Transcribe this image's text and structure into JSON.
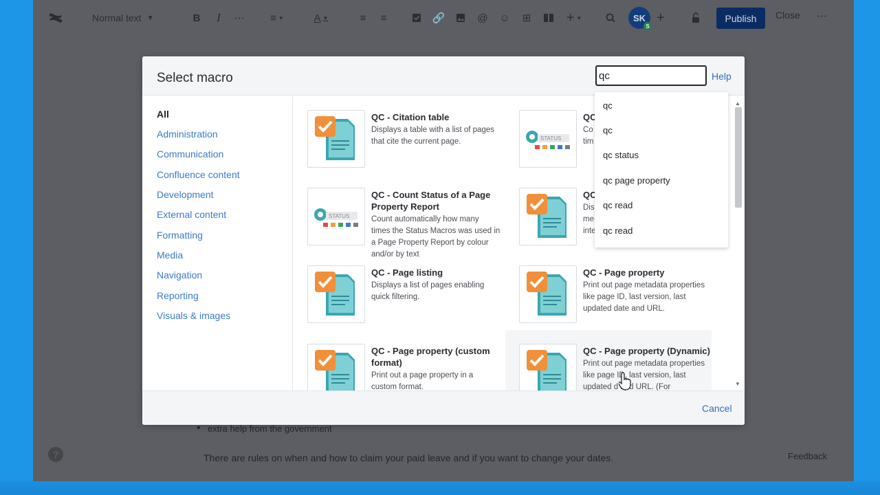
{
  "toolbar": {
    "text_style": "Normal text",
    "avatar_initials": "SK",
    "avatar_badge": "S",
    "publish_label": "Publish",
    "close_label": "Close"
  },
  "modal": {
    "title": "Select macro",
    "search_value": "qc",
    "help_label": "Help",
    "cancel_label": "Cancel",
    "categories": [
      {
        "label": "All"
      },
      {
        "label": "Administration"
      },
      {
        "label": "Communication"
      },
      {
        "label": "Confluence content"
      },
      {
        "label": "Development"
      },
      {
        "label": "External content"
      },
      {
        "label": "Formatting"
      },
      {
        "label": "Media"
      },
      {
        "label": "Navigation"
      },
      {
        "label": "Reporting"
      },
      {
        "label": "Visuals & images"
      }
    ],
    "macros": [
      {
        "title": "QC - Citation table",
        "desc1": "Displays a table with a list of pages",
        "desc2": "that cite the current page.",
        "desc3": "",
        "desc4": "",
        "icon": "qc-doc-icon"
      },
      {
        "title": "QC",
        "desc1": "Co",
        "desc2": "tim",
        "desc3": "",
        "desc4": "",
        "icon": "status-icon"
      },
      {
        "title": "QC - Count Status of a Page",
        "title2": "Property Report",
        "desc1": "Count automatically how many",
        "desc2": "times the Status Macros was used in",
        "desc3": "a Page Property Report by colour",
        "desc4": "and/or by text",
        "icon": "status-icon"
      },
      {
        "title": "QC",
        "desc1": "Dis",
        "desc2": "me",
        "desc3": "inte",
        "desc4": "",
        "icon": "qc-doc-icon"
      },
      {
        "title": "QC - Page listing",
        "desc1": "Displays a list of pages enabling",
        "desc2": "quick filtering.",
        "desc3": "",
        "desc4": "",
        "icon": "qc-doc-icon"
      },
      {
        "title": "QC - Page property",
        "desc1": "Print out page metadata properties",
        "desc2": "like page ID, last version, last",
        "desc3": "updated date and URL.",
        "desc4": "",
        "icon": "qc-doc-icon"
      },
      {
        "title": "QC - Page property (custom",
        "title2": "format)",
        "desc1": "Print out a page property in a",
        "desc2": "custom format.",
        "desc3": "",
        "desc4": "",
        "icon": "qc-doc-icon"
      },
      {
        "title": "QC - Page property (Dynamic)",
        "desc1": "Print out page metadata properties",
        "desc2": "like page ID, last version, last",
        "desc3": "updated d    and URL. (For",
        "desc4": "",
        "icon": "qc-doc-icon"
      }
    ],
    "suggestions": [
      {
        "label": "qc"
      },
      {
        "label": "qc"
      },
      {
        "label": "qc status"
      },
      {
        "label": "qc page property"
      },
      {
        "label": "qc read"
      },
      {
        "label": "qc read"
      }
    ]
  },
  "editor": {
    "bullet": "extra help from the government",
    "paragraph": "There are rules on when and how to claim your paid leave and if you want to change your dates.",
    "feedback_label": "Feedback"
  },
  "colors": {
    "primary": "#0b2c63",
    "link": "#2f6fc2",
    "check_orange": "#f0a030"
  }
}
